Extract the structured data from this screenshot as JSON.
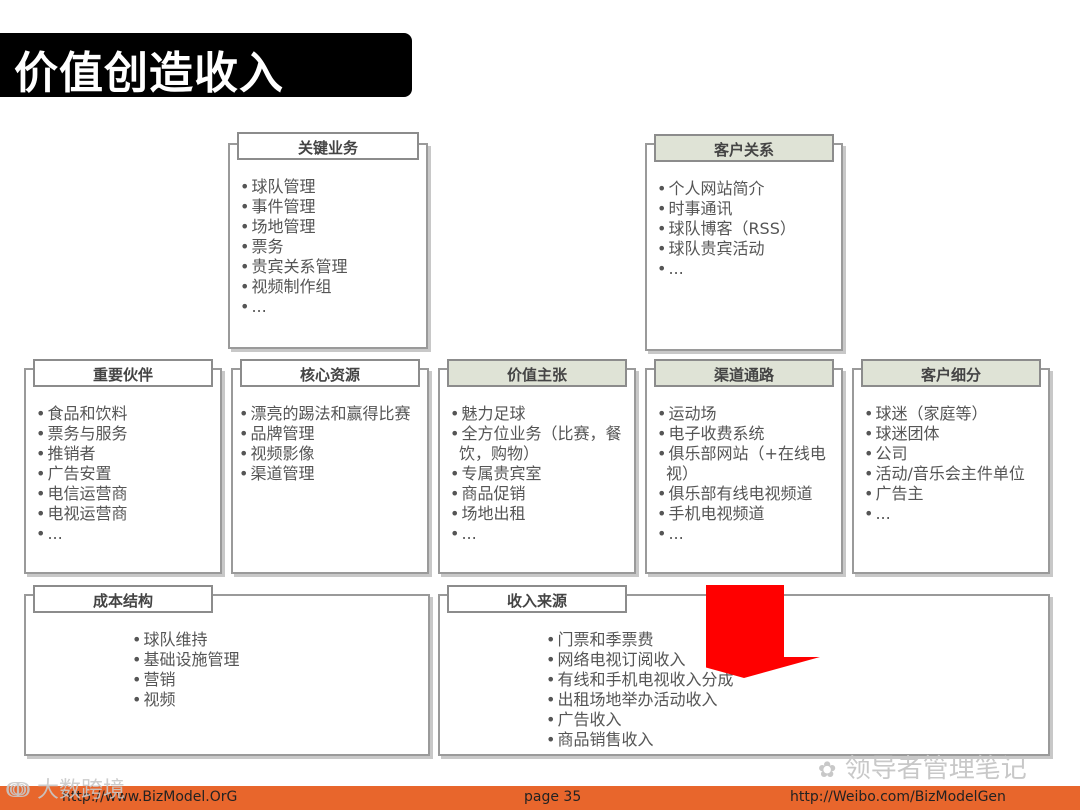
{
  "title": "价值创造收入",
  "boxes": {
    "key_activities": {
      "label": "关键业务",
      "items": [
        "球队管理",
        "事件管理",
        "场地管理",
        "票务",
        "贵宾关系管理",
        "视频制作组",
        "..."
      ]
    },
    "customer_relationships": {
      "label": "客户关系",
      "items": [
        "个人网站简介",
        "时事通讯",
        "球队博客（RSS）",
        "球队贵宾活动",
        "..."
      ]
    },
    "key_partners": {
      "label": "重要伙伴",
      "items": [
        "食品和饮料",
        "票务与服务",
        "推销者",
        "广告安置",
        "电信运营商",
        "电视运营商",
        "..."
      ]
    },
    "key_resources": {
      "label": "核心资源",
      "items": [
        "漂亮的踢法和赢得比赛",
        "品牌管理",
        "视频影像",
        "渠道管理"
      ]
    },
    "value_propositions": {
      "label": "价值主张",
      "items": [
        "魅力足球",
        "全方位业务（比赛，餐饮，购物）",
        "专属贵宾室",
        "商品促销",
        "场地出租",
        "..."
      ]
    },
    "channels": {
      "label": "渠道通路",
      "items": [
        "运动场",
        "电子收费系统",
        "俱乐部网站（+在线电视）",
        "俱乐部有线电视频道",
        "手机电视频道",
        "..."
      ]
    },
    "customer_segments": {
      "label": "客户细分",
      "items": [
        "球迷（家庭等）",
        "球迷团体",
        "公司",
        "活动/音乐会主件单位",
        "广告主",
        "..."
      ]
    },
    "cost_structure": {
      "label": "成本结构",
      "items": [
        "球队维持",
        "基础设施管理",
        "营销",
        "视频"
      ]
    },
    "revenue_streams": {
      "label": "收入来源",
      "items": [
        "门票和季票费",
        "网络电视订阅收入",
        "有线和手机电视收入分成",
        "出租场地举办活动收入",
        "广告收入",
        "商品销售收入"
      ]
    }
  },
  "footer": {
    "left": "http://www.BizModel.OrG",
    "center": "page 35",
    "right": "http://Weibo.com/BizModelGen"
  },
  "watermarks": {
    "bottom_left": "大数跨境",
    "bottom_right": "领导者管理笔记"
  },
  "colors": {
    "title_bg": "#000000",
    "footer_bg": "#e8662c",
    "arrow": "#ff0000",
    "highlight_label_bg": "#dfe3d6"
  }
}
